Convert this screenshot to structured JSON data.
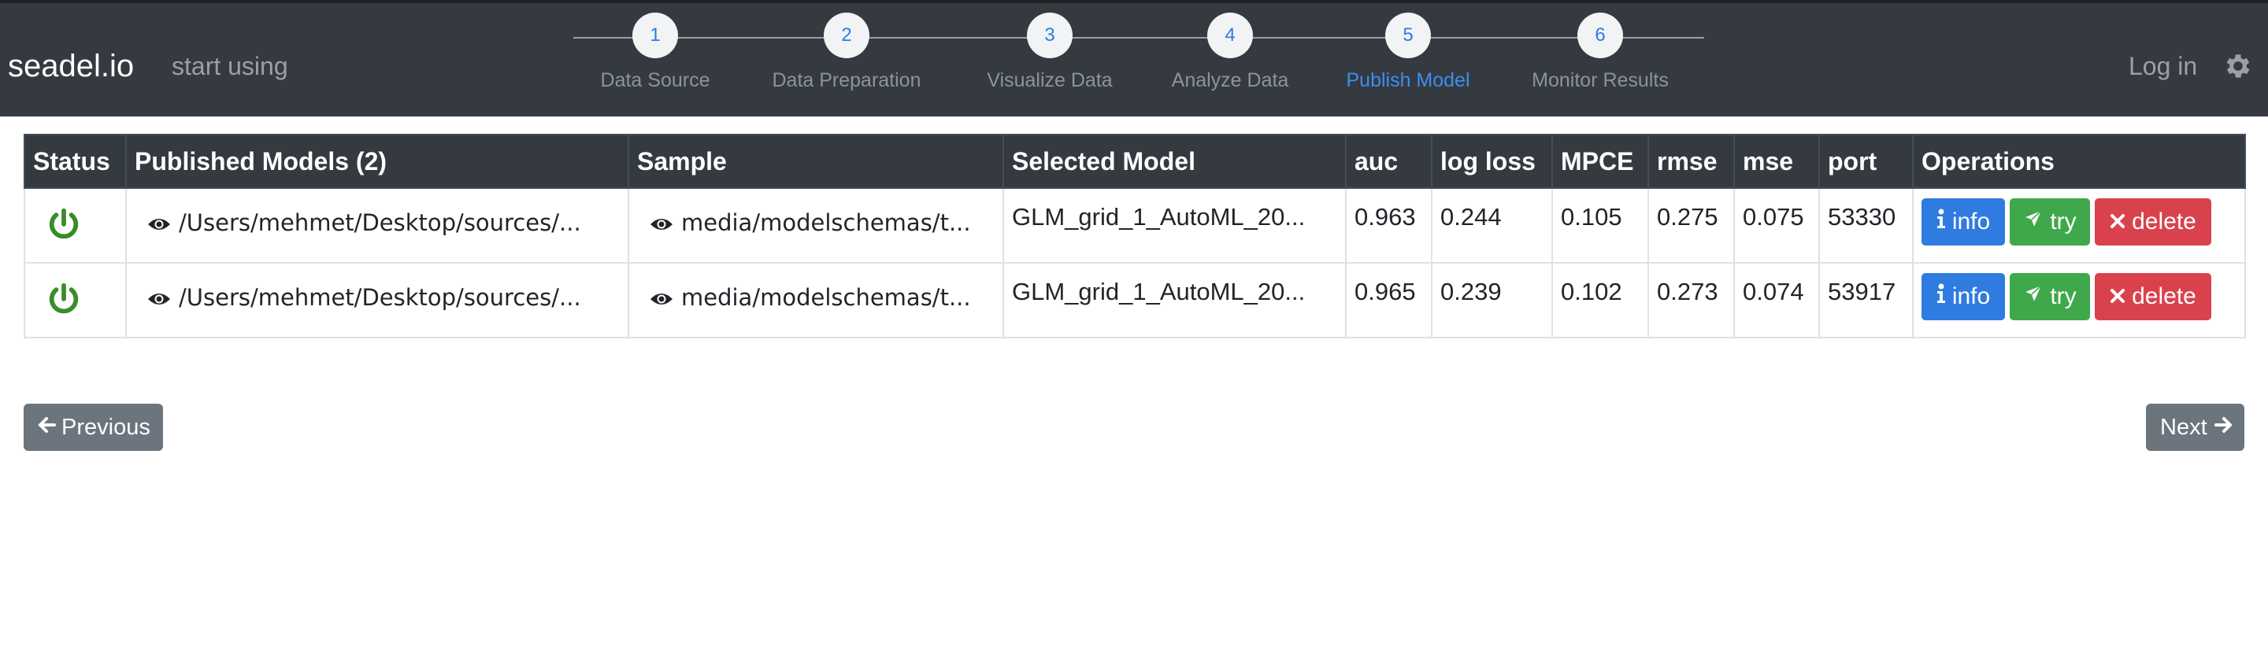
{
  "navbar": {
    "brand": "seadel.io",
    "start_using": "start using",
    "login": "Log in",
    "settings_icon": "gear-icon",
    "steps": [
      {
        "number": "1",
        "label": "Data Source"
      },
      {
        "number": "2",
        "label": "Data Preparation"
      },
      {
        "number": "3",
        "label": "Visualize Data"
      },
      {
        "number": "4",
        "label": "Analyze Data"
      },
      {
        "number": "5",
        "label": "Publish Model",
        "active": true
      },
      {
        "number": "6",
        "label": "Monitor Results"
      }
    ]
  },
  "table": {
    "headers": [
      "Status",
      "Published Models (2)",
      "Sample",
      "Selected Model",
      "auc",
      "log loss",
      "MPCE",
      "rmse",
      "mse",
      "port",
      "Operations"
    ],
    "rows": [
      {
        "status_icon": "power-icon",
        "model_path": "/Users/mehmet/Desktop/sources/...",
        "sample": "media/modelschemas/t...",
        "selected_model": "GLM_grid_1_AutoML_20...",
        "auc": "0.963",
        "log_loss": "0.244",
        "mpce": "0.105",
        "rmse": "0.275",
        "mse": "0.075",
        "port": "53330"
      },
      {
        "status_icon": "power-icon",
        "model_path": "/Users/mehmet/Desktop/sources/...",
        "sample": "media/modelschemas/t...",
        "selected_model": "GLM_grid_1_AutoML_20...",
        "auc": "0.965",
        "log_loss": "0.239",
        "mpce": "0.102",
        "rmse": "0.273",
        "mse": "0.074",
        "port": "53917"
      }
    ],
    "operations": {
      "info_label": "info",
      "try_label": "try",
      "delete_label": "delete"
    }
  },
  "pager": {
    "previous_label": "Previous",
    "next_label": "Next"
  },
  "colors": {
    "navbar_bg": "#343a40",
    "accent_blue": "#2f7be0",
    "active_step": "#3d8ef0",
    "success_green": "#3fa84a",
    "danger_red": "#d9424d",
    "secondary_gray": "#6c757d",
    "status_green": "#3a8c2a"
  }
}
